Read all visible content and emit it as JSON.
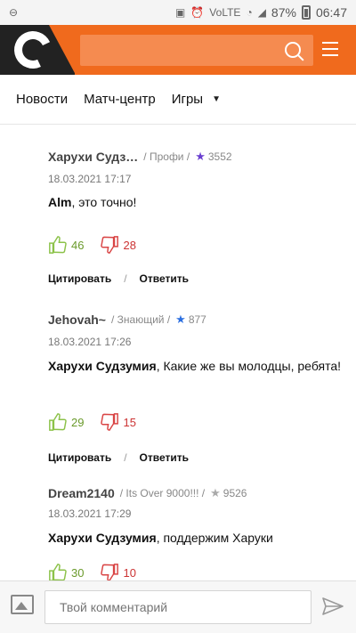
{
  "statusbar": {
    "battery": "87%",
    "time": "06:47",
    "network": "VoLTE"
  },
  "header": {
    "logo_letter": "С",
    "search_placeholder": ""
  },
  "nav": {
    "items": [
      "Новости",
      "Матч-центр",
      "Игры"
    ]
  },
  "comments": [
    {
      "author": "Харухи Судз…",
      "rank": "/ Профи /",
      "star_color": "#6a3fd0",
      "score": "3552",
      "date": "18.03.2021 17:17",
      "mention": "Alm",
      "text": ", это точно!",
      "likes": "46",
      "dislikes": "28",
      "quote": "Цитировать",
      "reply": "Ответить"
    },
    {
      "author": "Jehovah~",
      "rank": "/ Знающий /",
      "star_color": "#2c6fe0",
      "score": "877",
      "date": "18.03.2021 17:26",
      "mention": "Харухи Судзумия",
      "text": ", Какие же вы молодцы, ребята!",
      "likes": "29",
      "dislikes": "15",
      "quote": "Цитировать",
      "reply": "Ответить"
    },
    {
      "author": "Dream2140",
      "rank": "/ Its Over 9000!!! /",
      "star_color": "#aaaaaa",
      "score": "9526",
      "date": "18.03.2021 17:29",
      "mention": "Харухи Судзумия",
      "text": ", поддержим Харуки",
      "likes": "30",
      "dislikes": "10"
    }
  ],
  "comment_box": {
    "placeholder": "Твой комментарий"
  },
  "colors": {
    "brand_orange": "#f06a1d",
    "like_green": "#6a9a2b",
    "dislike_red": "#cc3333"
  }
}
